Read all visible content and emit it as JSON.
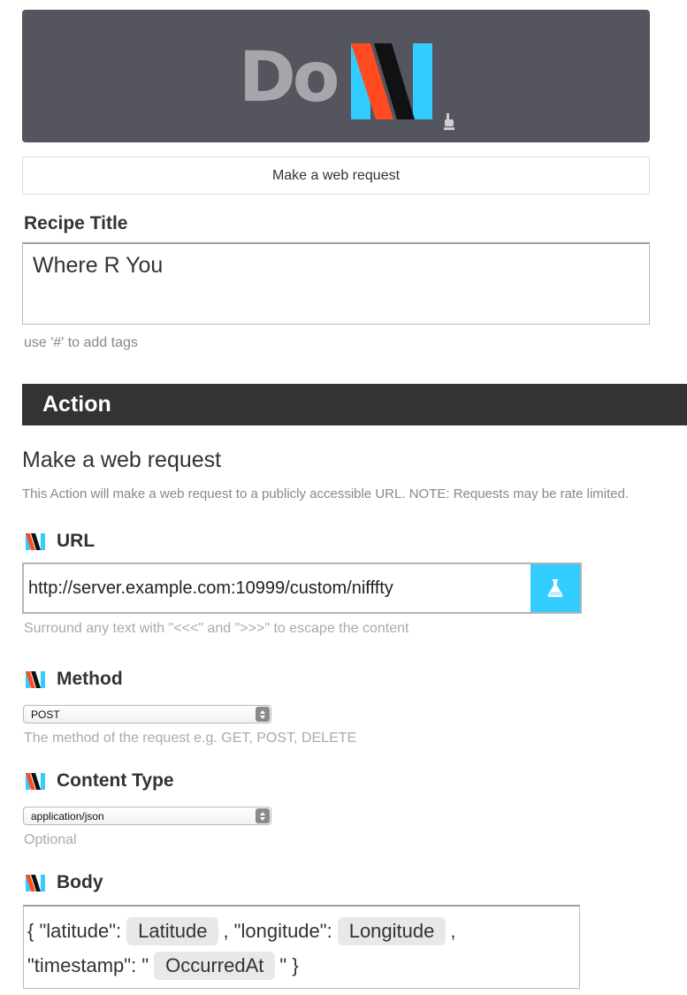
{
  "brand": {
    "do_text": "Do",
    "colors": {
      "blue": "#33ccff",
      "red": "#ff4b1f",
      "black": "#111111",
      "header_bg": "#555560"
    }
  },
  "applet_button": {
    "label": "Make a web request"
  },
  "recipe": {
    "label": "Recipe Title",
    "value": "Where R You",
    "hint": "use '#' to add tags"
  },
  "section": {
    "title": "Action"
  },
  "action": {
    "title": "Make a web request",
    "description": "This Action will make a web request to a publicly accessible URL. NOTE: Requests may be rate limited."
  },
  "fields": {
    "url": {
      "label": "URL",
      "value": "http://server.example.com:10999/custom/nifffty",
      "hint": "Surround any text with \"<<<\" and \">>>\" to escape the content",
      "test_icon": "flask-icon"
    },
    "method": {
      "label": "Method",
      "selected": "POST",
      "hint": "The method of the request e.g. GET, POST, DELETE"
    },
    "content_type": {
      "label": "Content Type",
      "selected": "application/json",
      "hint": "Optional"
    },
    "body": {
      "label": "Body",
      "t1": "{ \"latitude\":",
      "ing1": "Latitude",
      "t2": ", \"longitude\":",
      "ing2": "Longitude",
      "t3": ",",
      "t4": "\"timestamp\": \"",
      "ing3": "OccurredAt",
      "t5": "\" }"
    }
  }
}
